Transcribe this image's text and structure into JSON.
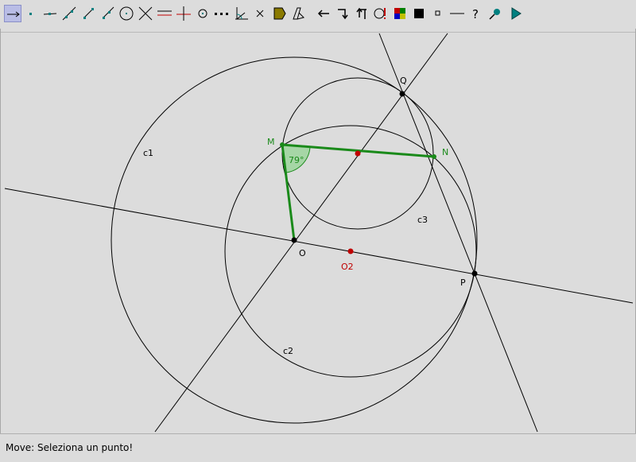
{
  "toolbar": {
    "tools": [
      {
        "name": "move-tool-icon",
        "active": true
      },
      {
        "name": "new-point-icon"
      },
      {
        "name": "point-on-line-icon"
      },
      {
        "name": "line-through-points-icon"
      },
      {
        "name": "segment-icon"
      },
      {
        "name": "ray-icon"
      },
      {
        "name": "circle-center-point-icon"
      },
      {
        "name": "intersect-icon"
      },
      {
        "name": "parallel-line-icon"
      },
      {
        "name": "perpendicular-line-icon"
      },
      {
        "name": "midpoint-icon"
      },
      {
        "name": "locus-icon"
      },
      {
        "name": "angle-icon"
      },
      {
        "name": "delete-icon"
      },
      {
        "name": "polygon-icon"
      },
      {
        "name": "text-icon"
      },
      {
        "name": "undo-icon"
      },
      {
        "name": "redo-down-icon"
      },
      {
        "name": "redo-up-icon"
      },
      {
        "name": "macro-icon"
      },
      {
        "name": "color-palette-icon"
      },
      {
        "name": "fill-icon"
      },
      {
        "name": "small-point-icon"
      },
      {
        "name": "line-style-icon"
      },
      {
        "name": "help-icon"
      },
      {
        "name": "pick-icon"
      },
      {
        "name": "play-icon"
      }
    ]
  },
  "labels": {
    "c1": "c1",
    "c2": "c2",
    "c3": "c3",
    "Q": "Q",
    "M": "M",
    "N": "N",
    "O": "O",
    "O2": "O2",
    "P": "P",
    "angle": "79°"
  },
  "colors": {
    "green": "#1a8a1a",
    "red": "#c00000",
    "angle_fill": "#a6d6a6"
  },
  "status": {
    "text": "Move: Seleziona un punto!"
  }
}
